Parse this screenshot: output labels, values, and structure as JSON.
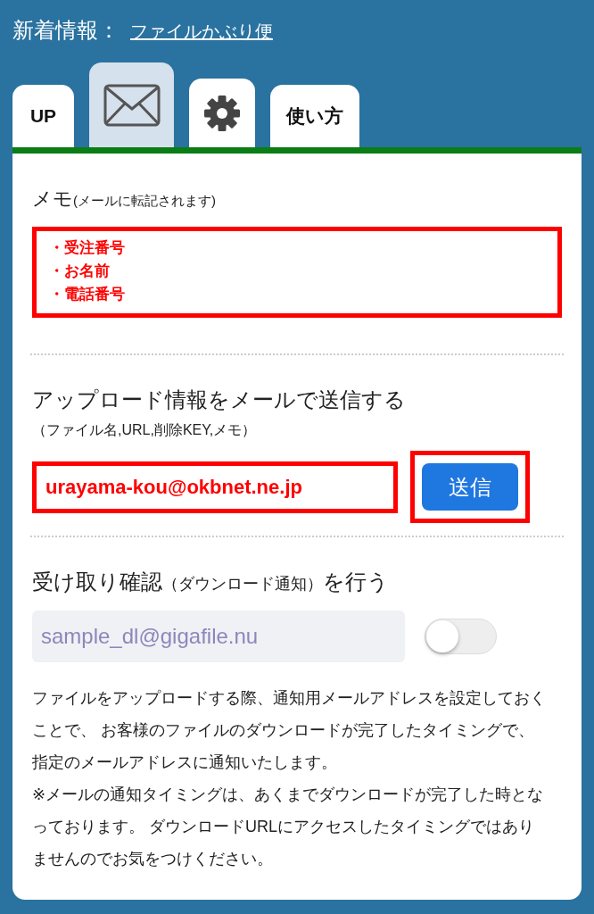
{
  "news": {
    "label": "新着情報：",
    "link": "ファイルかぶり便"
  },
  "tabs": [
    {
      "kind": "text",
      "label": "UP",
      "selected": false
    },
    {
      "kind": "mail",
      "selected": true
    },
    {
      "kind": "gear",
      "selected": false
    },
    {
      "kind": "text",
      "label": "使い方",
      "selected": false
    }
  ],
  "memo": {
    "title": "メモ",
    "note": "(メールに転記されます)",
    "lines": [
      "・受注番号",
      "・お名前",
      "・電話番号"
    ]
  },
  "send": {
    "title": "アップロード情報をメールで送信する",
    "subtitle": "（ファイル名,URL,削除KEY,メモ）",
    "email": "urayama-kou@okbnet.ne.jp",
    "button": "送信"
  },
  "receipt": {
    "title": "受け取り確認",
    "title_note": "（ダウンロード通知）",
    "title_end": "を行う",
    "placeholder": "sample_dl@gigafile.nu",
    "on": false
  },
  "description": [
    "ファイルをアップロードする際、通知用メールアドレスを設定しておくことで、 お客様のファイルのダウンロードが完了したタイミングで、指定のメールアドレスに通知いたします。",
    "※メールの通知タイミングは、あくまでダウンロードが完了した時となっております。 ダウンロードURLにアクセスしたタイミングではありませんのでお気をつけください。"
  ]
}
